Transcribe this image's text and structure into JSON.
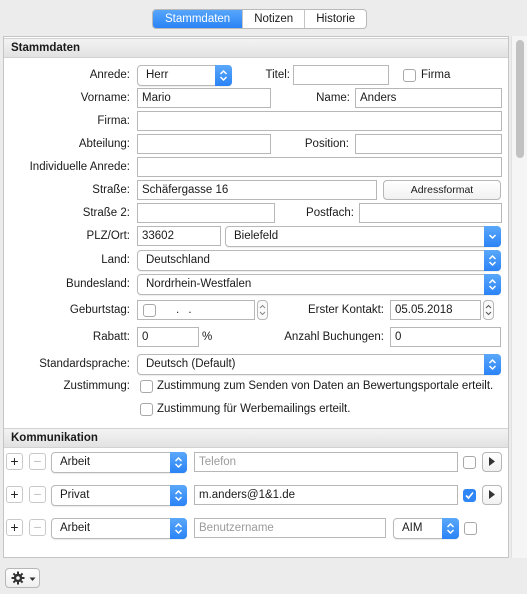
{
  "tabs": [
    {
      "label": "Stammdaten",
      "active": true
    },
    {
      "label": "Notizen",
      "active": false
    },
    {
      "label": "Historie",
      "active": false
    }
  ],
  "stammdaten": {
    "section_title": "Stammdaten",
    "anrede": {
      "label": "Anrede:",
      "value": "Herr"
    },
    "titel": {
      "label": "Titel:",
      "value": ""
    },
    "firma_check": {
      "label": "Firma",
      "checked": false
    },
    "vorname": {
      "label": "Vorname:",
      "value": "Mario"
    },
    "name": {
      "label": "Name:",
      "value": "Anders"
    },
    "firma": {
      "label": "Firma:",
      "value": ""
    },
    "abteilung": {
      "label": "Abteilung:",
      "value": ""
    },
    "position": {
      "label": "Position:",
      "value": ""
    },
    "indiv_anrede": {
      "label": "Individuelle Anrede:",
      "value": ""
    },
    "strasse": {
      "label": "Straße:",
      "value": "Schäfergasse 16"
    },
    "adressformat_label": "Adressformat",
    "strasse2": {
      "label": "Straße 2:",
      "value": ""
    },
    "postfach": {
      "label": "Postfach:",
      "value": ""
    },
    "plz_ort": {
      "label": "PLZ/Ort:",
      "plz": "33602",
      "ort": "Bielefeld"
    },
    "land": {
      "label": "Land:",
      "value": "Deutschland"
    },
    "bundesland": {
      "label": "Bundesland:",
      "value": "Nordrhein-Westfalen"
    },
    "geburtstag": {
      "label": "Geburtstag:",
      "value": ". ."
    },
    "erster_kontakt": {
      "label": "Erster Kontakt:",
      "value": "05.05.2018"
    },
    "rabatt": {
      "label": "Rabatt:",
      "value": "0",
      "unit": "%"
    },
    "anzahl_buchungen": {
      "label": "Anzahl Buchungen:",
      "value": "0"
    },
    "standardsprache": {
      "label": "Standardsprache:",
      "value": "Deutsch (Default)"
    },
    "zustimmung": {
      "label": "Zustimmung:",
      "bewertung": "Zustimmung zum Senden von Daten an Bewertungsportale erteilt.",
      "werbe": "Zustimmung für Werbemailings erteilt."
    }
  },
  "kommunikation": {
    "section_title": "Kommunikation",
    "rows": [
      {
        "type": "Arbeit",
        "value": "",
        "placeholder": "Telefon",
        "checked": false
      },
      {
        "type": "Privat",
        "value": "m.anders@1&1.de",
        "placeholder": "",
        "checked": true
      },
      {
        "type": "Arbeit",
        "value": "",
        "placeholder": "Benutzername",
        "service": "AIM",
        "checked": false
      }
    ],
    "plus_label": "+",
    "minus_label": "−"
  }
}
